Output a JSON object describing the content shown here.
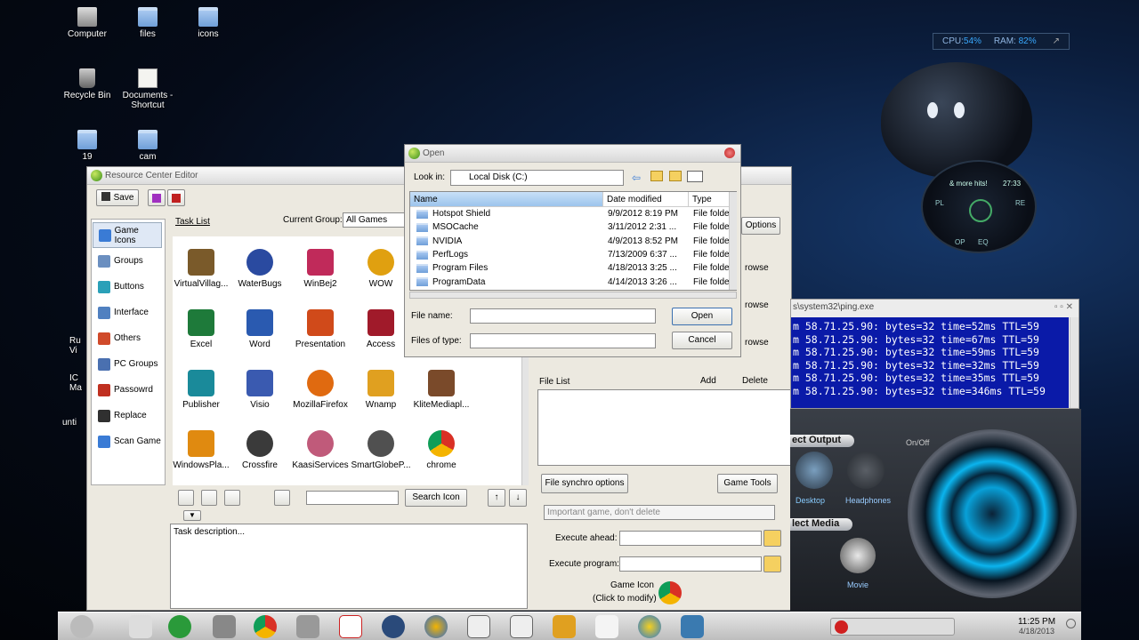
{
  "desktop": {
    "icons": [
      {
        "label": "Computer"
      },
      {
        "label": "files"
      },
      {
        "label": "icons"
      },
      {
        "label": "Recycle Bin"
      },
      {
        "label": "Documents - Shortcut"
      },
      {
        "label": "19"
      },
      {
        "label": "cam"
      }
    ],
    "partial_labels": [
      "Ru",
      "Vi",
      "IC",
      "Ma",
      "unti"
    ]
  },
  "widget": {
    "cpu_label": "CPU:",
    "cpu_value": "54%",
    "ram_label": "RAM:",
    "ram_value": "82%"
  },
  "remote": {
    "hits": "& more hits!",
    "time": "27:33",
    "buttons": [
      "PL",
      "RE",
      "OP",
      "EQ"
    ]
  },
  "rce": {
    "title": "Resource Center Editor",
    "toolbar": {
      "save_label": "Save"
    },
    "task_list_label": "Task List",
    "current_group_label": "Current Group:",
    "current_group_value": "All Games",
    "sidebar": [
      {
        "label": "Game Icons",
        "color": "#3a7bd5"
      },
      {
        "label": "Groups",
        "color": "#6b8fc0"
      },
      {
        "label": "Buttons",
        "color": "#2aa0b8"
      },
      {
        "label": "Interface",
        "color": "#5080c0"
      },
      {
        "label": "Others",
        "color": "#d04a2a"
      },
      {
        "label": "PC Groups",
        "color": "#4a70b0"
      },
      {
        "label": "Passowrd",
        "color": "#c03020"
      },
      {
        "label": "Replace",
        "color": "#303030"
      },
      {
        "label": "Scan Game",
        "color": "#3a7bd5"
      }
    ],
    "apps": [
      {
        "label": "VirtualVillag...",
        "color": "#7a5a2a"
      },
      {
        "label": "WaterBugs",
        "color": "#2a4aa0"
      },
      {
        "label": "WinBej2",
        "color": "#c02a5a"
      },
      {
        "label": "WOW",
        "color": "#e0a010"
      },
      {
        "label": "Excel",
        "color": "#1e7a3a"
      },
      {
        "label": "Word",
        "color": "#2a5ab0"
      },
      {
        "label": "Presentation",
        "color": "#d04a1a"
      },
      {
        "label": "Access",
        "color": "#a01a2a"
      },
      {
        "label": "Publisher",
        "color": "#1a8a9a"
      },
      {
        "label": "Visio",
        "color": "#3a5ab0"
      },
      {
        "label": "MozillaFirefox",
        "color": "#e06a10"
      },
      {
        "label": "Wnamp",
        "color": "#e0a020"
      },
      {
        "label": "KliteMediapl...",
        "color": "#7a4a2a"
      },
      {
        "label": "WindowsPla...",
        "color": "#e08a10"
      },
      {
        "label": "Crossfire",
        "color": "#3a3a3a"
      },
      {
        "label": "KaasiServices",
        "color": "#c05a7a"
      },
      {
        "label": "SmartGlobeP...",
        "color": "#505050"
      },
      {
        "label": "chrome",
        "color": "#2a9a3a"
      }
    ],
    "search_button": "Search Icon",
    "task_description_placeholder": "Task description...",
    "options_button": "Options",
    "browse_labels": [
      "rowse",
      "rowse",
      "rowse"
    ],
    "file_list_label": "File List",
    "add_label": "Add",
    "delete_label": "Delete",
    "file_synchro_button": "File synchro options",
    "game_tools_button": "Game Tools",
    "important_select": "Important game, don't delete",
    "execute_ahead_label": "Execute ahead:",
    "execute_program_label": "Execute program:",
    "game_icon_label": "Game Icon",
    "game_icon_hint": "(Click to modify)"
  },
  "open_dialog": {
    "title": "Open",
    "look_in_label": "Look in:",
    "look_in_value": "Local Disk (C:)",
    "columns": [
      "Name",
      "Date modified",
      "Type"
    ],
    "rows": [
      {
        "name": "Hotspot Shield",
        "date": "9/9/2012 8:19 PM",
        "type": "File folde"
      },
      {
        "name": "MSOCache",
        "date": "3/11/2012 2:31 ...",
        "type": "File folde"
      },
      {
        "name": "NVIDIA",
        "date": "4/9/2013 8:52 PM",
        "type": "File folde"
      },
      {
        "name": "PerfLogs",
        "date": "7/13/2009 6:37 ...",
        "type": "File folde"
      },
      {
        "name": "Program Files",
        "date": "4/18/2013 3:25 ...",
        "type": "File folde"
      },
      {
        "name": "ProgramData",
        "date": "4/14/2013 3:26 ...",
        "type": "File folde"
      }
    ],
    "file_name_label": "File name:",
    "file_name_value": "",
    "files_of_type_label": "Files of type:",
    "files_of_type_value": "",
    "open_button": "Open",
    "cancel_button": "Cancel"
  },
  "ping": {
    "title": "s\\system32\\ping.exe",
    "lines": [
      "m 58.71.25.90: bytes=32 time=52ms TTL=59",
      "m 58.71.25.90: bytes=32 time=67ms TTL=59",
      "m 58.71.25.90: bytes=32 time=59ms TTL=59",
      "m 58.71.25.90: bytes=32 time=32ms TTL=59",
      "m 58.71.25.90: bytes=32 time=35ms TTL=59",
      "m 58.71.25.90: bytes=32 time=346ms TTL=59"
    ]
  },
  "audio": {
    "select_output": "ect Output",
    "on_off": "On/Off",
    "desktop_label": "Desktop",
    "headphones_label": "Headphones",
    "select_media": "lect Media",
    "movie_label": "Movie"
  },
  "taskbar": {
    "time": "11:25 PM",
    "date": "4/18/2013",
    "apps": [
      "finder",
      "library",
      "tools",
      "calculator",
      "chrome",
      "scanner",
      "vc",
      "globe",
      "media",
      "editor",
      "window",
      "winamp",
      "notepad",
      "loader",
      "photos"
    ]
  }
}
